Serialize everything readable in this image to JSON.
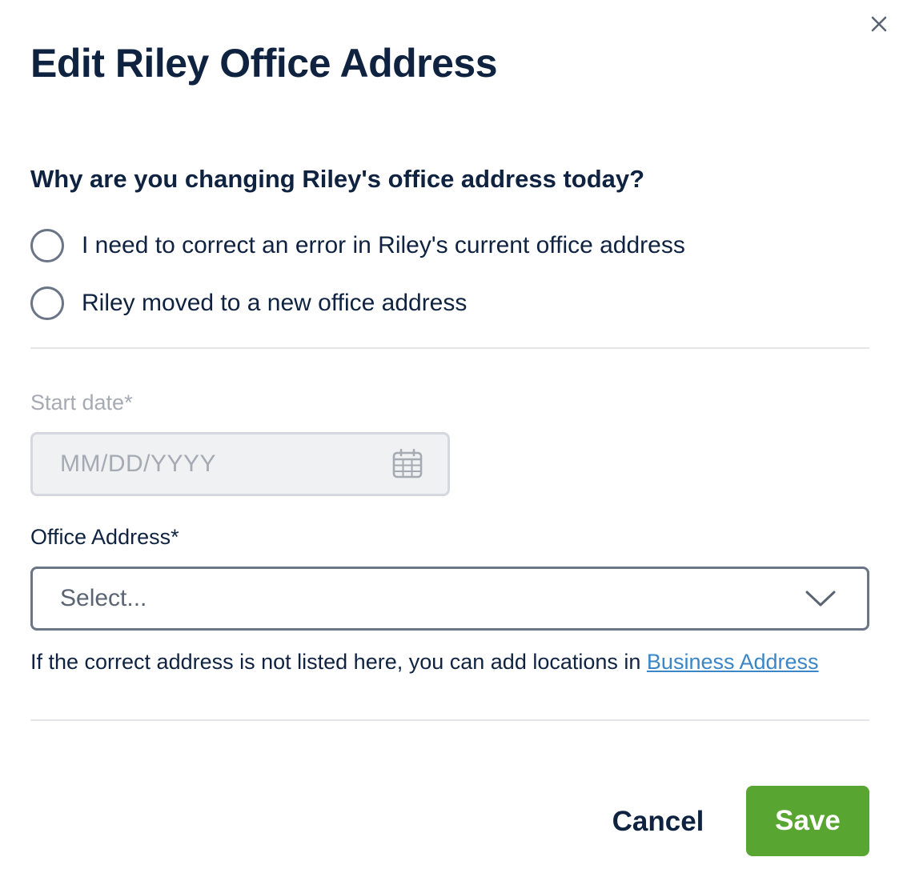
{
  "dialog": {
    "title": "Edit Riley Office Address",
    "close_icon": "close-icon"
  },
  "reason": {
    "question": "Why are you changing Riley's office address today?",
    "options": [
      {
        "label": "I need to correct an error in Riley's current office address",
        "selected": false
      },
      {
        "label": "Riley moved to a new office address",
        "selected": false
      }
    ]
  },
  "start_date": {
    "label": "Start date*",
    "placeholder": "MM/DD/YYYY",
    "disabled": true,
    "icon": "calendar-icon"
  },
  "office_address": {
    "label": "Office Address*",
    "value": "Select...",
    "icon": "chevron-down-icon"
  },
  "helper": {
    "text": "If the correct address is not listed here, you can add locations in ",
    "link_text": "Business Address"
  },
  "actions": {
    "cancel_label": "Cancel",
    "save_label": "Save"
  },
  "colors": {
    "primary_text": "#0f2341",
    "save_button": "#58a531",
    "link": "#3a86c6",
    "disabled_text": "#a5aab3"
  }
}
